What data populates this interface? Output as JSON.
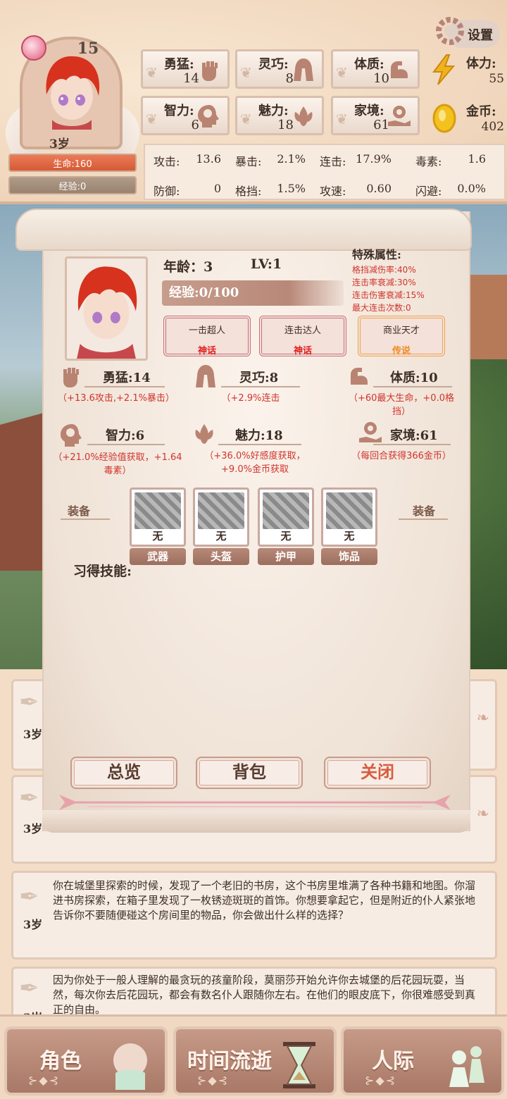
{
  "header": {
    "level": "15",
    "age": "3岁",
    "hp_label": "生命:160",
    "exp_label": "经验:0",
    "settings_label": "设置",
    "stats": [
      {
        "label": "勇猛:",
        "value": "14",
        "icon": "fist-icon"
      },
      {
        "label": "灵巧:",
        "value": "8",
        "icon": "cloak-icon"
      },
      {
        "label": "体质:",
        "value": "10",
        "icon": "arm-icon"
      },
      {
        "label": "智力:",
        "value": "6",
        "icon": "brain-head-icon"
      },
      {
        "label": "魅力:",
        "value": "18",
        "icon": "flower-icon"
      },
      {
        "label": "家境:",
        "value": "61",
        "icon": "coin-hand-icon"
      }
    ],
    "stamina": {
      "label": "体力:",
      "value": "55"
    },
    "gold": {
      "label": "金币:",
      "value": "402"
    },
    "combat": [
      {
        "label": "攻击:",
        "value": "13.6"
      },
      {
        "label": "暴击:",
        "value": "2.1%"
      },
      {
        "label": "连击:",
        "value": "17.9%"
      },
      {
        "label": "毒素:",
        "value": "1.6"
      },
      {
        "label": "防御:",
        "value": "0"
      },
      {
        "label": "格挡:",
        "value": "1.5%"
      },
      {
        "label": "攻速:",
        "value": "0.60"
      },
      {
        "label": "闪避:",
        "value": "0.0%"
      }
    ]
  },
  "log": [
    {
      "age": "3岁",
      "text": ""
    },
    {
      "age": "3岁",
      "text": ""
    },
    {
      "age": "3岁",
      "text": "你在城堡里探索的时候，发现了一个老旧的书房，这个书房里堆满了各种书籍和地图。你溜进书房探索，在箱子里发现了一枚锈迹斑斑的首饰。你想要拿起它，但是附近的仆人紧张地告诉你不要随便碰这个房间里的物品，你会做出什么样的选择？"
    },
    {
      "age": "3岁",
      "text": "因为你处于一般人理解的最贪玩的孩童阶段，莫丽莎开始允许你去城堡的后花园玩耍，当然，每次你去后花园玩，都会有数名仆人跟随你左右。在他们的眼皮底下，你很难感受到真正的自由。"
    }
  ],
  "modal": {
    "age_label": "年龄：",
    "age_value": "3",
    "lv_label": "LV:1",
    "exp_label": "经验:0/100",
    "special_title": "特殊属性:",
    "special": [
      "格挡减伤率:40%",
      "连击率衰减:30%",
      "连击伤害衰减:15%",
      "最大连击次数:0"
    ],
    "talents": [
      {
        "name": "一击超人",
        "rarity": "神话"
      },
      {
        "name": "连击达人",
        "rarity": "神话"
      },
      {
        "name": "商业天才",
        "rarity": "传说"
      }
    ],
    "attributes": [
      {
        "name": "勇猛:14",
        "desc": "（+13.6攻击,+2.1%暴击）",
        "icon": "fist-icon"
      },
      {
        "name": "灵巧:8",
        "desc": "（+2.9%连击",
        "icon": "cloak-icon"
      },
      {
        "name": "体质:10",
        "desc": "（+60最大生命，+0.0格挡）",
        "icon": "arm-icon"
      },
      {
        "name": "智力:6",
        "desc": "（+21.0%经验值获取，+1.64毒素）",
        "icon": "brain-head-icon"
      },
      {
        "name": "魅力:18",
        "desc": "（+36.0%好感度获取，+9.0%金币获取",
        "icon": "flower-icon"
      },
      {
        "name": "家境:61",
        "desc": "（每回合获得366金币）",
        "icon": "coin-hand-icon"
      }
    ],
    "equip_side_label": "装备",
    "equipment": [
      {
        "slot": "武器",
        "value": "无"
      },
      {
        "slot": "头盔",
        "value": "无"
      },
      {
        "slot": "护甲",
        "value": "无"
      },
      {
        "slot": "饰品",
        "value": "无"
      }
    ],
    "skills_title": "习得技能:",
    "buttons": {
      "overview": "总览",
      "bag": "背包",
      "close": "关闭"
    }
  },
  "nav": {
    "character": "角色",
    "time": "时间流逝",
    "social": "人际"
  }
}
